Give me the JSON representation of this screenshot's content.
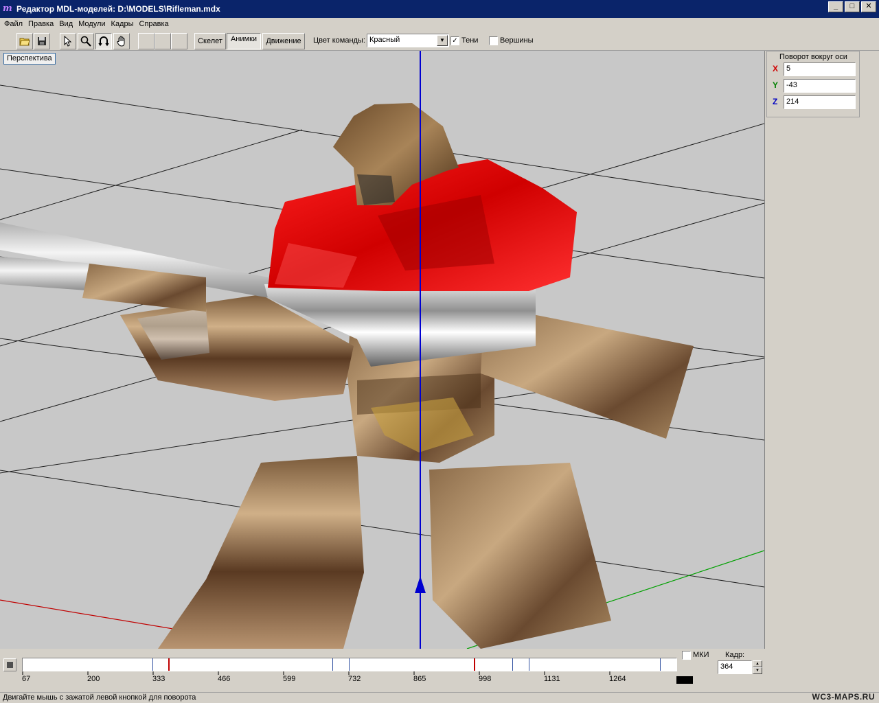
{
  "window": {
    "title": "Редактор MDL-моделей: D:\\MODELS\\Rifleman.mdx",
    "icon": "mdl-app-icon",
    "controls": [
      "_",
      "□",
      "✕"
    ]
  },
  "menu": [
    "Файл",
    "Правка",
    "Вид",
    "Модули",
    "Кадры",
    "Справка"
  ],
  "toolbar": {
    "tabs": [
      "Скелет",
      "Анимки",
      "Движение"
    ],
    "team_color_label": "Цвет команды:",
    "team_color_value": "Красный",
    "shadows_label": "Тени",
    "shadows_checked": "✓",
    "vertices_label": "Вершины"
  },
  "viewport": {
    "view_mode_button": "Перспектива"
  },
  "rotation_panel": {
    "title": "Поворот вокруг оси",
    "axes": [
      {
        "label": "X",
        "value": "5",
        "color": "#d00000"
      },
      {
        "label": "Y",
        "value": "-43",
        "color": "#008000"
      },
      {
        "label": "Z",
        "value": "214",
        "color": "#0000c0"
      }
    ]
  },
  "timeline": {
    "ticks": [
      "67",
      "200",
      "333",
      "466",
      "599",
      "732",
      "865",
      "998",
      "1131",
      "1264"
    ],
    "mki_label": "МКИ",
    "frame_label": "Кадр:",
    "frame_value": "364"
  },
  "status": {
    "text": "Двигайте мышь с зажатой левой кнопкой для поворота",
    "watermark": "WC3-MAPS.RU"
  }
}
